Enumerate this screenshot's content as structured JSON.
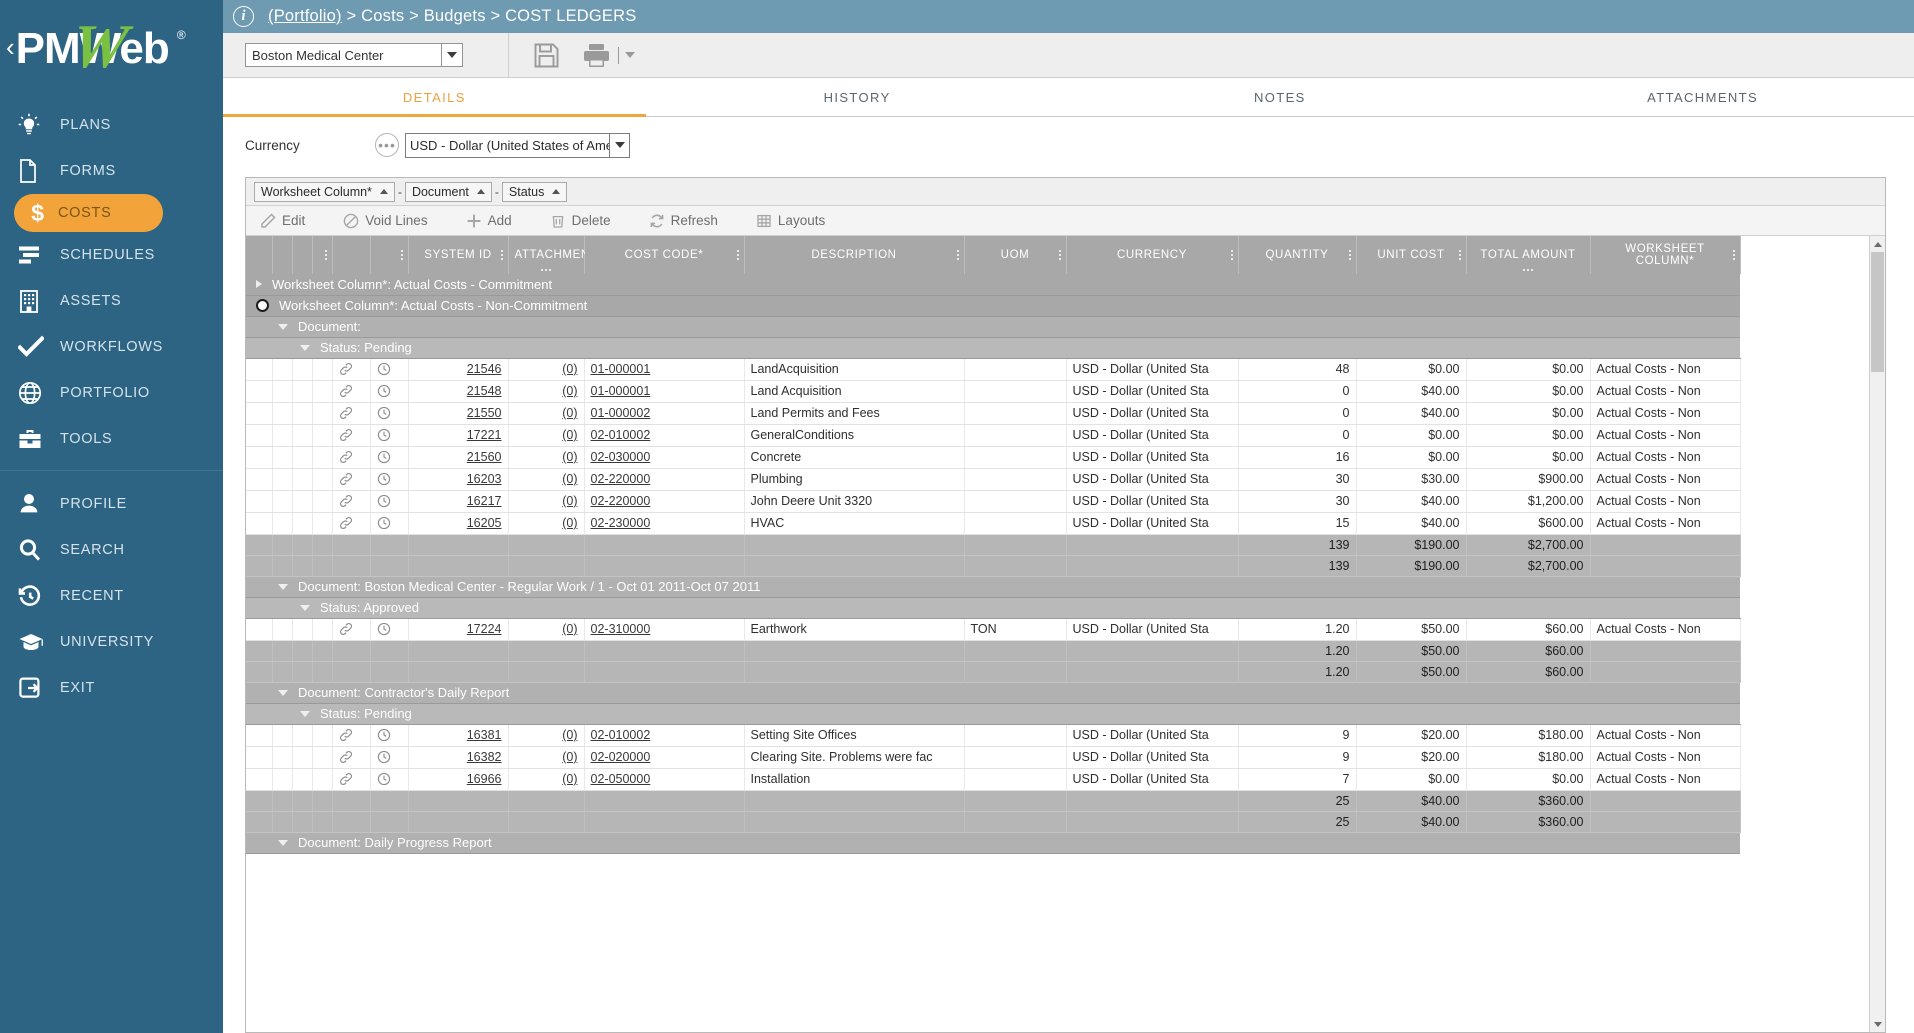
{
  "brand": {
    "name": "PMWeb",
    "registered": "®",
    "collapse_icon": "chevron-left-icon"
  },
  "sidebar": {
    "items": [
      {
        "label": "PLANS",
        "icon": "lightbulb-icon",
        "active": false
      },
      {
        "label": "FORMS",
        "icon": "document-icon",
        "active": false
      },
      {
        "label": "COSTS",
        "icon": "dollar-icon",
        "active": true
      },
      {
        "label": "SCHEDULES",
        "icon": "gantt-icon",
        "active": false
      },
      {
        "label": "ASSETS",
        "icon": "building-icon",
        "active": false
      },
      {
        "label": "WORKFLOWS",
        "icon": "checkmark-icon",
        "active": false
      },
      {
        "label": "PORTFOLIO",
        "icon": "globe-icon",
        "active": false
      },
      {
        "label": "TOOLS",
        "icon": "toolbox-icon",
        "active": false
      }
    ],
    "items_lower": [
      {
        "label": "PROFILE",
        "icon": "person-icon"
      },
      {
        "label": "SEARCH",
        "icon": "magnifier-icon"
      },
      {
        "label": "RECENT",
        "icon": "history-clock-icon"
      },
      {
        "label": "UNIVERSITY",
        "icon": "graduation-cap-icon"
      },
      {
        "label": "EXIT",
        "icon": "exit-door-icon"
      }
    ]
  },
  "header": {
    "info_icon": "info-circle-icon",
    "breadcrumb_link": "(Portfolio)",
    "breadcrumb_rest": " > Costs > Budgets > COST LEDGERS"
  },
  "toolbar": {
    "project_value": "Boston Medical Center",
    "save_icon": "save-floppy-icon",
    "print_icon": "printer-icon",
    "print_caret_icon": "caret-down-icon"
  },
  "tabs": [
    {
      "label": "DETAILS",
      "active": true
    },
    {
      "label": "HISTORY",
      "active": false
    },
    {
      "label": "NOTES",
      "active": false
    },
    {
      "label": "ATTACHMENTS",
      "active": false
    }
  ],
  "currency": {
    "label": "Currency",
    "ellipsis_label": "•••",
    "value": "USD - Dollar (United States of Ameri"
  },
  "grouping": {
    "chips": [
      "Worksheet Column*",
      "Document",
      "Status"
    ],
    "separator": "-"
  },
  "commands": [
    {
      "label": "Edit",
      "icon": "pencil-icon"
    },
    {
      "label": "Void Lines",
      "icon": "void-circle-slash-icon"
    },
    {
      "label": "Add",
      "icon": "plus-icon"
    },
    {
      "label": "Delete",
      "icon": "trash-icon"
    },
    {
      "label": "Refresh",
      "icon": "refresh-icon"
    },
    {
      "label": "Layouts",
      "icon": "layouts-grid-icon"
    }
  ],
  "table": {
    "columns": [
      "SYSTEM ID",
      "ATTACHMEN",
      "COST CODE*",
      "DESCRIPTION",
      "UOM",
      "CURRENCY",
      "QUANTITY",
      "UNIT COST",
      "TOTAL AMOUNT",
      "WORKSHEET COLUMN*"
    ],
    "groups": [
      {
        "level": 1,
        "collapsed": true,
        "label": "Worksheet Column*: Actual Costs - Commitment"
      },
      {
        "level": 1,
        "collapsed": false,
        "selected": true,
        "label": "Worksheet Column*: Actual Costs - Non-Commitment"
      },
      {
        "level": 2,
        "label": "Document:"
      },
      {
        "level": 3,
        "label": "Status: Pending"
      }
    ],
    "rows_block1": [
      {
        "link_icon": "link-icon",
        "clock_icon": "clock-icon",
        "system_id": "21546",
        "attachments": "(0)",
        "cost_code": "01-000001",
        "description": "LandAcquisition",
        "uom": "",
        "currency": "USD - Dollar (United Sta",
        "quantity": "48",
        "unit_cost": "$0.00",
        "total_amount": "$0.00",
        "worksheet_column": "Actual Costs - Non"
      },
      {
        "link_icon": "link-icon",
        "clock_icon": "clock-icon",
        "system_id": "21548",
        "attachments": "(0)",
        "cost_code": "01-000001",
        "description": "Land Acquisition",
        "uom": "",
        "currency": "USD - Dollar (United Sta",
        "quantity": "0",
        "unit_cost": "$40.00",
        "total_amount": "$0.00",
        "worksheet_column": "Actual Costs - Non"
      },
      {
        "link_icon": "link-icon",
        "clock_icon": "clock-icon",
        "system_id": "21550",
        "attachments": "(0)",
        "cost_code": "01-000002",
        "description": "Land Permits and Fees",
        "uom": "",
        "currency": "USD - Dollar (United Sta",
        "quantity": "0",
        "unit_cost": "$40.00",
        "total_amount": "$0.00",
        "worksheet_column": "Actual Costs - Non"
      },
      {
        "link_icon": "link-icon",
        "clock_icon": "clock-icon",
        "system_id": "17221",
        "attachments": "(0)",
        "cost_code": "02-010002",
        "description": "GeneralConditions",
        "uom": "",
        "currency": "USD - Dollar (United Sta",
        "quantity": "0",
        "unit_cost": "$0.00",
        "total_amount": "$0.00",
        "worksheet_column": "Actual Costs - Non"
      },
      {
        "link_icon": "link-icon",
        "clock_icon": "clock-icon",
        "system_id": "21560",
        "attachments": "(0)",
        "cost_code": "02-030000",
        "description": "Concrete",
        "uom": "",
        "currency": "USD - Dollar (United Sta",
        "quantity": "16",
        "unit_cost": "$0.00",
        "total_amount": "$0.00",
        "worksheet_column": "Actual Costs - Non"
      },
      {
        "link_icon": "link-icon",
        "clock_icon": "clock-icon",
        "system_id": "16203",
        "attachments": "(0)",
        "cost_code": "02-220000",
        "description": "Plumbing",
        "uom": "",
        "currency": "USD - Dollar (United Sta",
        "quantity": "30",
        "unit_cost": "$30.00",
        "total_amount": "$900.00",
        "worksheet_column": "Actual Costs - Non"
      },
      {
        "link_icon": "link-icon",
        "clock_icon": "clock-icon",
        "system_id": "16217",
        "attachments": "(0)",
        "cost_code": "02-220000",
        "description": "John Deere Unit 3320",
        "uom": "",
        "currency": "USD - Dollar (United Sta",
        "quantity": "30",
        "unit_cost": "$40.00",
        "total_amount": "$1,200.00",
        "worksheet_column": "Actual Costs - Non"
      },
      {
        "link_icon": "link-icon",
        "clock_icon": "clock-icon",
        "system_id": "16205",
        "attachments": "(0)",
        "cost_code": "02-230000",
        "description": "HVAC",
        "uom": "",
        "currency": "USD - Dollar (United Sta",
        "quantity": "15",
        "unit_cost": "$40.00",
        "total_amount": "$600.00",
        "worksheet_column": "Actual Costs - Non"
      }
    ],
    "totals_block1": [
      {
        "quantity": "139",
        "unit_cost": "$190.00",
        "total_amount": "$2,700.00"
      },
      {
        "quantity": "139",
        "unit_cost": "$190.00",
        "total_amount": "$2,700.00"
      }
    ],
    "group_doc2": "Document: Boston Medical Center - Regular Work / 1 - Oct 01 2011-Oct 07 2011",
    "group_status2": "Status: Approved",
    "rows_block2": [
      {
        "link_icon": "link-icon",
        "clock_icon": "clock-icon",
        "system_id": "17224",
        "attachments": "(0)",
        "cost_code": "02-310000",
        "description": "Earthwork",
        "uom": "TON",
        "currency": "USD - Dollar (United Sta",
        "quantity": "1.20",
        "unit_cost": "$50.00",
        "total_amount": "$60.00",
        "worksheet_column": "Actual Costs - Non"
      }
    ],
    "totals_block2": [
      {
        "quantity": "1.20",
        "unit_cost": "$50.00",
        "total_amount": "$60.00"
      },
      {
        "quantity": "1.20",
        "unit_cost": "$50.00",
        "total_amount": "$60.00"
      }
    ],
    "group_doc3": "Document: Contractor's Daily Report",
    "group_status3": "Status: Pending",
    "rows_block3": [
      {
        "link_icon": "link-icon",
        "clock_icon": "clock-icon",
        "system_id": "16381",
        "attachments": "(0)",
        "cost_code": "02-010002",
        "description": "Setting Site Offices",
        "uom": "",
        "currency": "USD - Dollar (United Sta",
        "quantity": "9",
        "unit_cost": "$20.00",
        "total_amount": "$180.00",
        "worksheet_column": "Actual Costs - Non"
      },
      {
        "link_icon": "link-icon",
        "clock_icon": "clock-icon",
        "system_id": "16382",
        "attachments": "(0)",
        "cost_code": "02-020000",
        "description": "Clearing Site. Problems were fac",
        "uom": "",
        "currency": "USD - Dollar (United Sta",
        "quantity": "9",
        "unit_cost": "$20.00",
        "total_amount": "$180.00",
        "worksheet_column": "Actual Costs - Non"
      },
      {
        "link_icon": "link-icon",
        "clock_icon": "clock-icon",
        "system_id": "16966",
        "attachments": "(0)",
        "cost_code": "02-050000",
        "description": "Installation",
        "uom": "",
        "currency": "USD - Dollar (United Sta",
        "quantity": "7",
        "unit_cost": "$0.00",
        "total_amount": "$0.00",
        "worksheet_column": "Actual Costs - Non"
      }
    ],
    "totals_block3": [
      {
        "quantity": "25",
        "unit_cost": "$40.00",
        "total_amount": "$360.00"
      },
      {
        "quantity": "25",
        "unit_cost": "$40.00",
        "total_amount": "$360.00"
      }
    ],
    "group_doc4": "Document: Daily Progress Report"
  },
  "colors": {
    "sidebar_bg": "#2d6383",
    "accent_orange": "#f2a43a",
    "brand_green": "#7ac143",
    "crumb_bg": "#6e9ab2",
    "header_grey": "#a8a8a8"
  }
}
